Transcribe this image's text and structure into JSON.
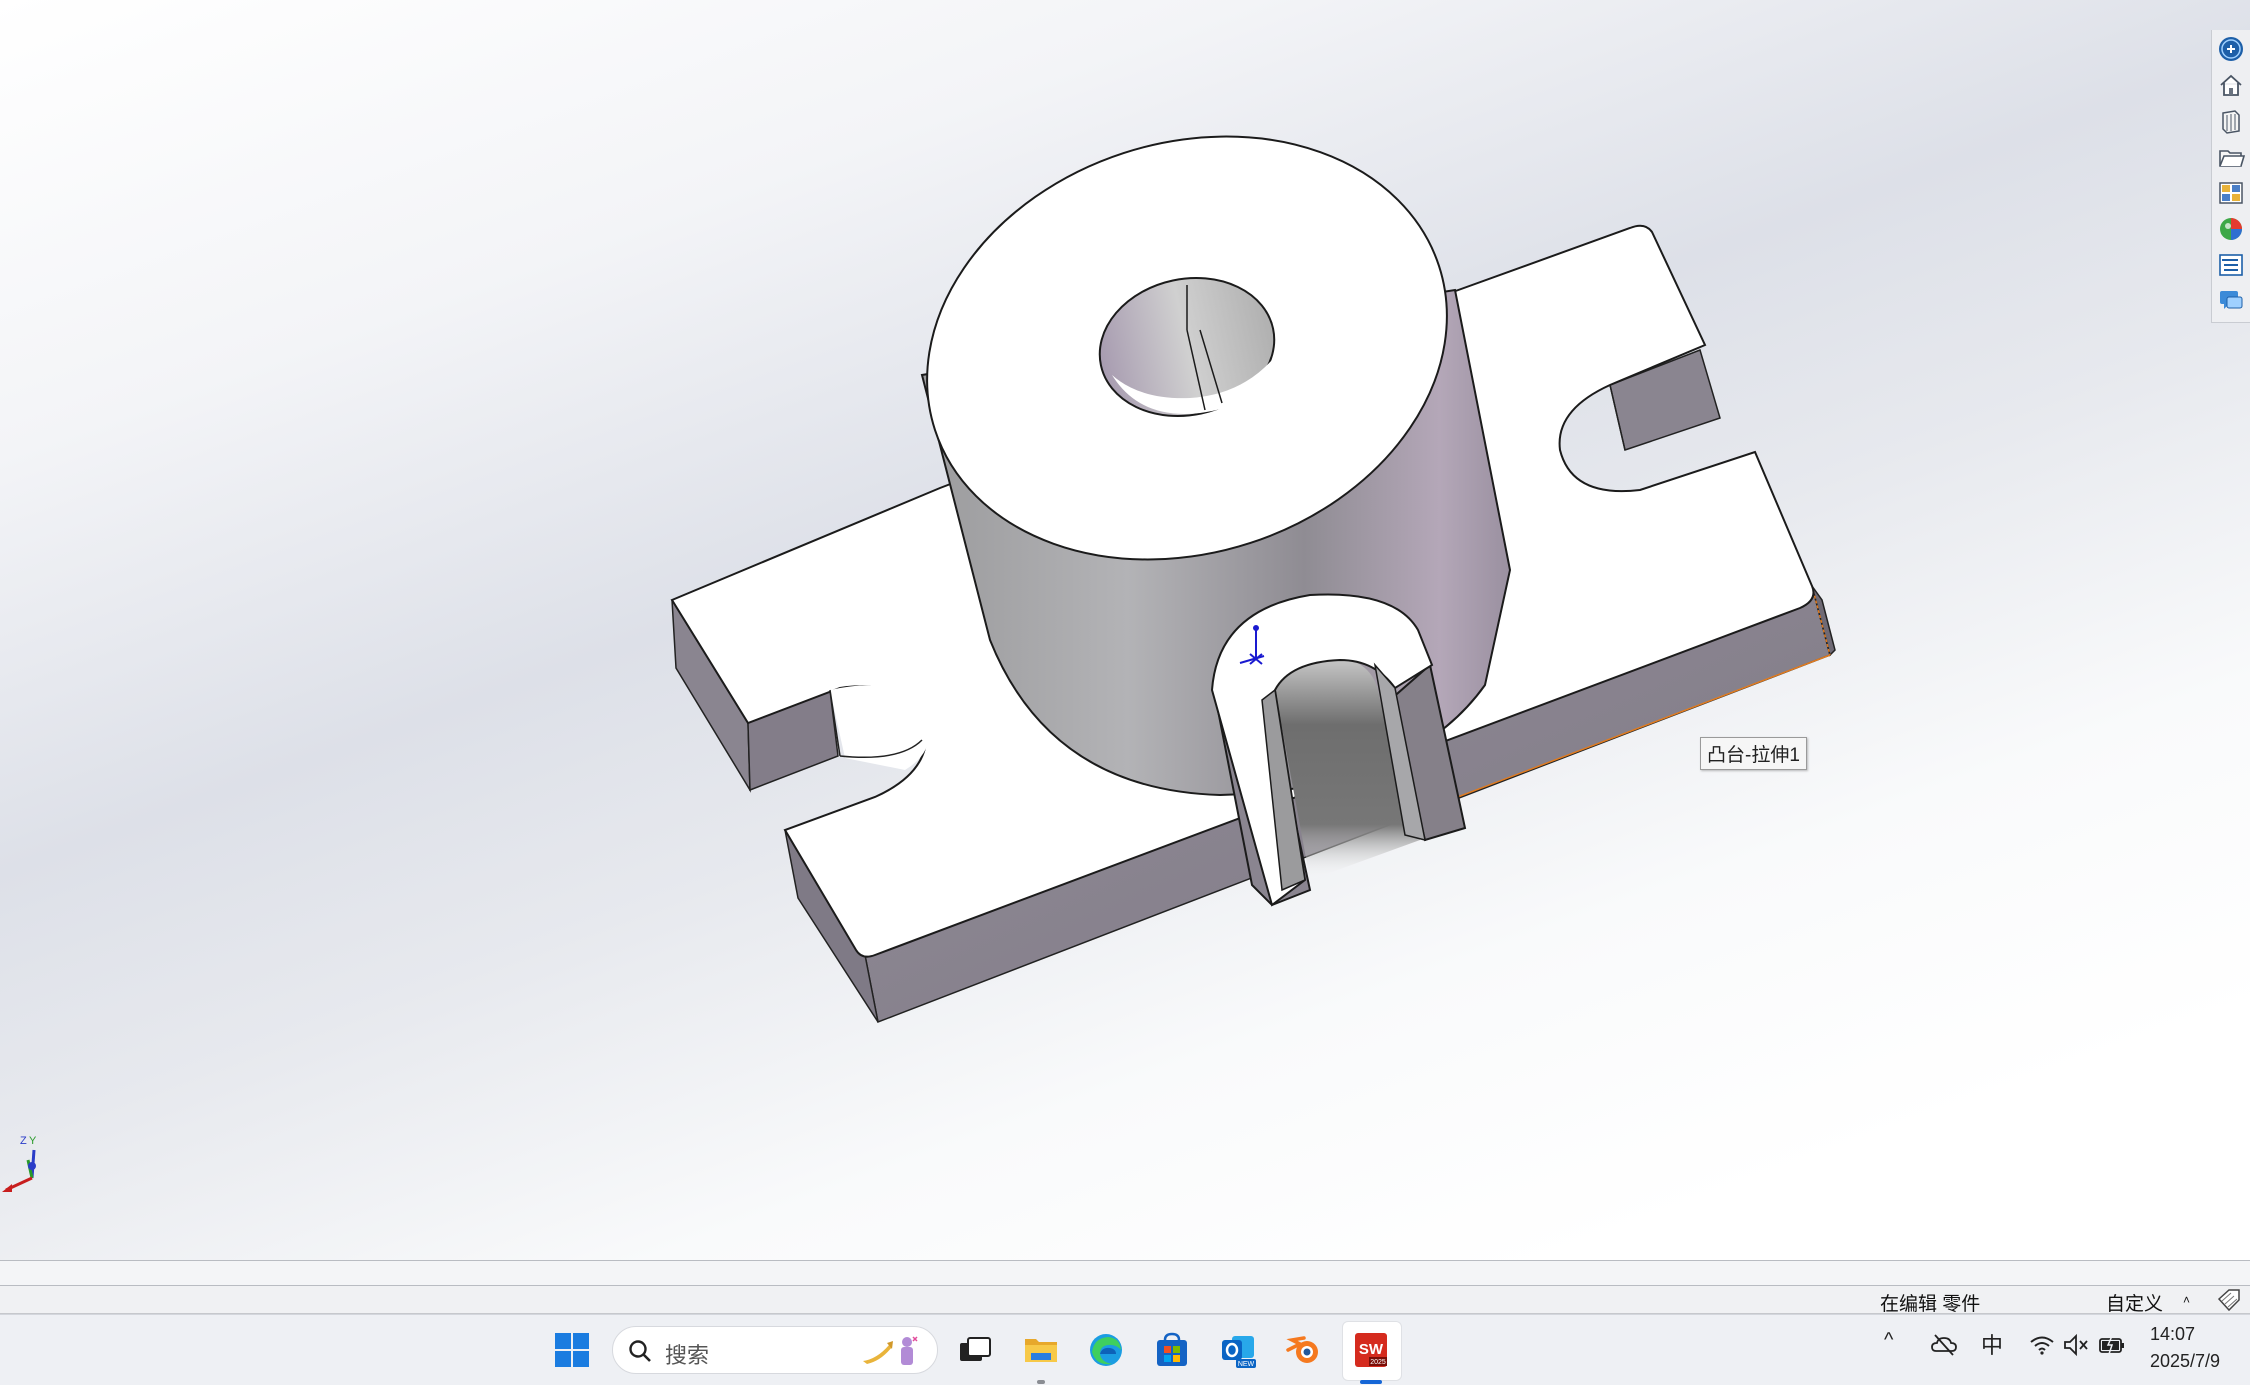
{
  "graphics": {
    "tooltip": "凸台-拉伸1",
    "triad_labels": {
      "z": "Z",
      "y": "Y"
    }
  },
  "taskpane": {
    "items": [
      {
        "icon": "solidworks-resources-icon"
      },
      {
        "icon": "home-icon"
      },
      {
        "icon": "design-library-icon"
      },
      {
        "icon": "file-explorer-folder-icon"
      },
      {
        "icon": "view-palette-icon"
      },
      {
        "icon": "appearances-scenes-icon"
      },
      {
        "icon": "custom-properties-icon"
      },
      {
        "icon": "forum-chat-icon"
      }
    ]
  },
  "status_bar": {
    "mode": "在编辑 零件",
    "units": "自定义",
    "units_arrow": "˄"
  },
  "taskbar": {
    "search_placeholder": "搜索",
    "apps": [
      {
        "name": "start",
        "icon": "windows-start-icon"
      },
      {
        "name": "task-view",
        "icon": "task-view-icon"
      },
      {
        "name": "file-explorer",
        "icon": "folder-icon",
        "running": true
      },
      {
        "name": "edge",
        "icon": "edge-icon"
      },
      {
        "name": "store",
        "icon": "store-icon"
      },
      {
        "name": "outlook-new",
        "icon": "outlook-icon",
        "badge": "NEW"
      },
      {
        "name": "blender",
        "icon": "blender-icon"
      },
      {
        "name": "solidworks",
        "icon": "solidworks-icon",
        "badge": "2025",
        "active": true
      }
    ],
    "tray": {
      "chevron": "^",
      "ime": "中",
      "time": "14:07",
      "date": "2025/7/9"
    }
  },
  "colors": {
    "accent": "#1566d6",
    "face_top": "#ffffff",
    "face_side": "#8c8692",
    "edge_highlight": "#e07b1f"
  }
}
